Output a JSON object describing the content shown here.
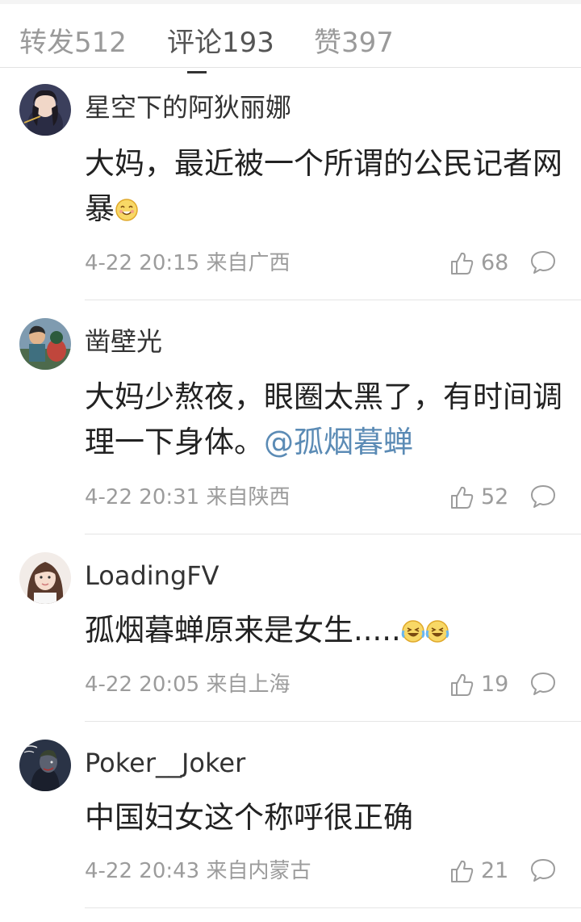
{
  "tabs": {
    "repost": "转发512",
    "comments": "评论193",
    "likes": "赞397"
  },
  "comments": [
    {
      "user": "星空下的阿狄丽娜",
      "text": "大妈，最近被一个所谓的公民记者网暴",
      "emoji": "smile-emoji",
      "time_location": "4-22 20:15 来自广西",
      "likes": "68"
    },
    {
      "user": "凿壁光",
      "text": "大妈少熬夜，眼圈太黑了，有时间调理一下身体。",
      "mention": "@孤烟暮蝉",
      "time_location": "4-22 20:31 来自陕西",
      "likes": "52"
    },
    {
      "user": "LoadingFV",
      "text": "孤烟暮蝉原来是女生.....",
      "emoji": "laugh-cry-emoji",
      "time_location": "4-22 20:05 来自上海",
      "likes": "19"
    },
    {
      "user": "Poker__Joker",
      "text": "中国妇女这个称呼很正确",
      "time_location": "4-22 20:43 来自内蒙古",
      "likes": "21"
    }
  ],
  "colors": {
    "mention": "#5b8bb5",
    "meta_text": "#9c9c9c",
    "active_tab": "#555555",
    "inactive_tab": "#9a9a9a"
  }
}
